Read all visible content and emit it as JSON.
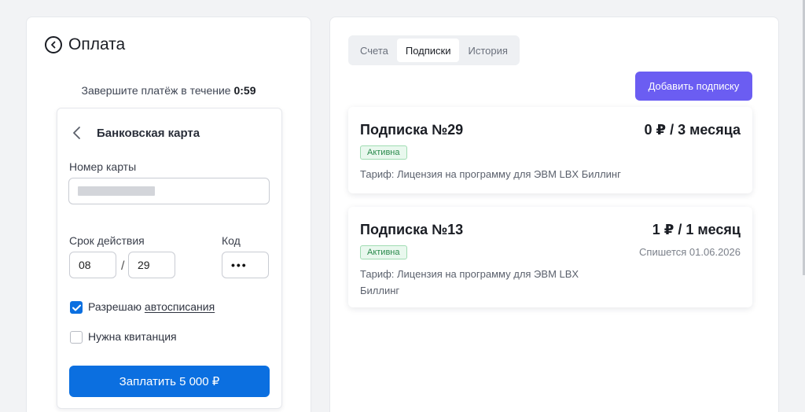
{
  "payment": {
    "title": "Оплата",
    "timer_prefix": "Завершите платёж в течение ",
    "timer_value": "0:59",
    "method_title": "Банковская карта",
    "card_number_label": "Номер карты",
    "expiry_label": "Срок действия",
    "expiry_month": "08",
    "expiry_slash": "/",
    "expiry_year": "29",
    "cvv_label": "Код",
    "cvv_value": "•••",
    "autopay_prefix": "Разрешаю ",
    "autopay_link": "автосписания",
    "autopay_checked": true,
    "receipt_label": "Нужна квитанция",
    "receipt_checked": false,
    "pay_button": "Заплатить  5 000 ₽"
  },
  "subscriptions": {
    "tabs": [
      {
        "label": "Счета",
        "active": false
      },
      {
        "label": "Подписки",
        "active": true
      },
      {
        "label": "История",
        "active": false
      }
    ],
    "add_button": "Добавить подписку",
    "items": [
      {
        "name": "Подписка №29",
        "price": "0 ₽ / 3 месяца",
        "status": "Активна",
        "tariff": "Тариф: Лицензия на программу для ЭВМ LBX Биллинг",
        "charge_date": ""
      },
      {
        "name": "Подписка №13",
        "price": "1 ₽ / 1 месяц",
        "status": "Активна",
        "tariff_line1": "Тариф: Лицензия на программу для ЭВМ LBX",
        "tariff_line2": "Биллинг",
        "charge_date": "Спишется 01.06.2026"
      }
    ]
  },
  "colors": {
    "primary_blue": "#0b6fe0",
    "accent_purple": "#6b5df2",
    "status_green": "#2a8a4c"
  }
}
